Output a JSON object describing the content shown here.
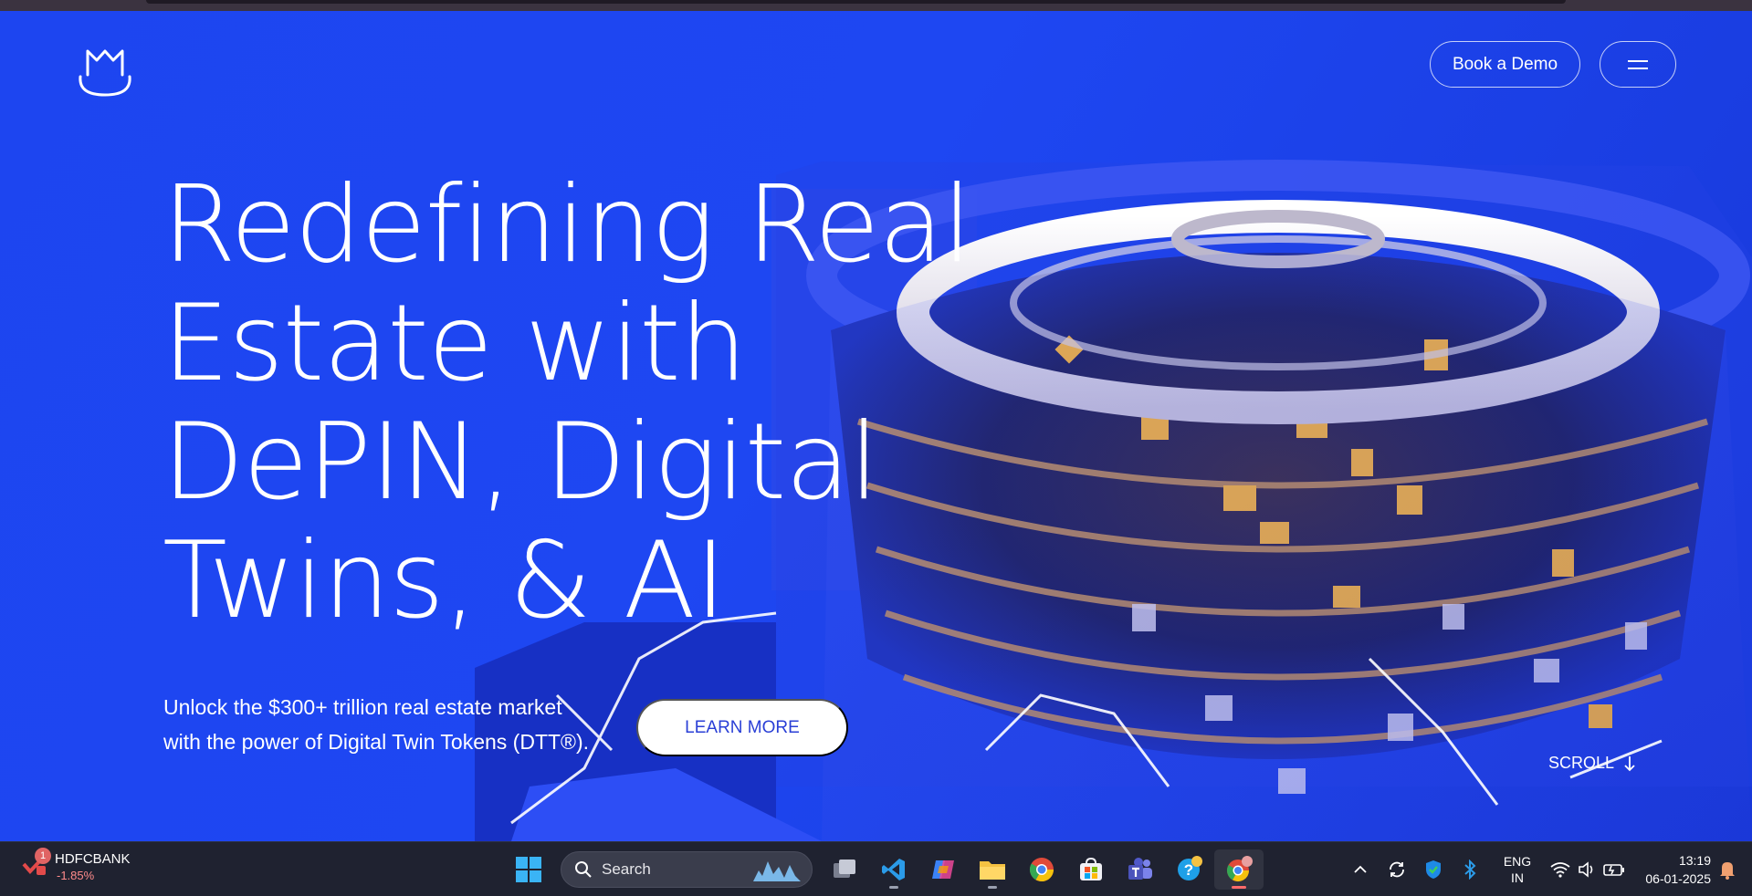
{
  "header": {
    "logo_alt": "M cat logo",
    "book_demo_label": "Book a Demo",
    "menu_icon": "hamburger-icon"
  },
  "hero": {
    "title_lines": [
      "Redefining Real",
      "Estate with",
      "DePIN, Digital",
      "Twins, & AI"
    ],
    "subtitle_lines": [
      "Unlock the $300+ trillion real estate market",
      "with the power of Digital Twin Tokens (DTT®)."
    ],
    "learn_more_label": "LEARN MORE",
    "scroll_label": "SCROLL",
    "scroll_icon": "arrow-down-icon"
  },
  "taskbar": {
    "stock": {
      "symbol": "HDFCBANK",
      "change": "-1.85%",
      "badge": "1"
    },
    "search_label": "Search",
    "apps": [
      {
        "name": "start-icon"
      },
      {
        "name": "task-view-icon"
      },
      {
        "name": "vscode-icon"
      },
      {
        "name": "copilot-icon"
      },
      {
        "name": "file-explorer-icon"
      },
      {
        "name": "chrome-icon"
      },
      {
        "name": "store-icon"
      },
      {
        "name": "teams-icon"
      },
      {
        "name": "help-icon"
      },
      {
        "name": "chrome-profile-icon"
      }
    ],
    "tray": {
      "lang_line1": "ENG",
      "lang_line2": "IN"
    },
    "clock": {
      "time": "13:19",
      "date": "06-01-2025"
    }
  },
  "colors": {
    "hero_bg": "#1d45f0",
    "learn_text": "#2a3fd6",
    "taskbar_bg": "#1f2230",
    "stock_negative": "#ff8b8b"
  }
}
